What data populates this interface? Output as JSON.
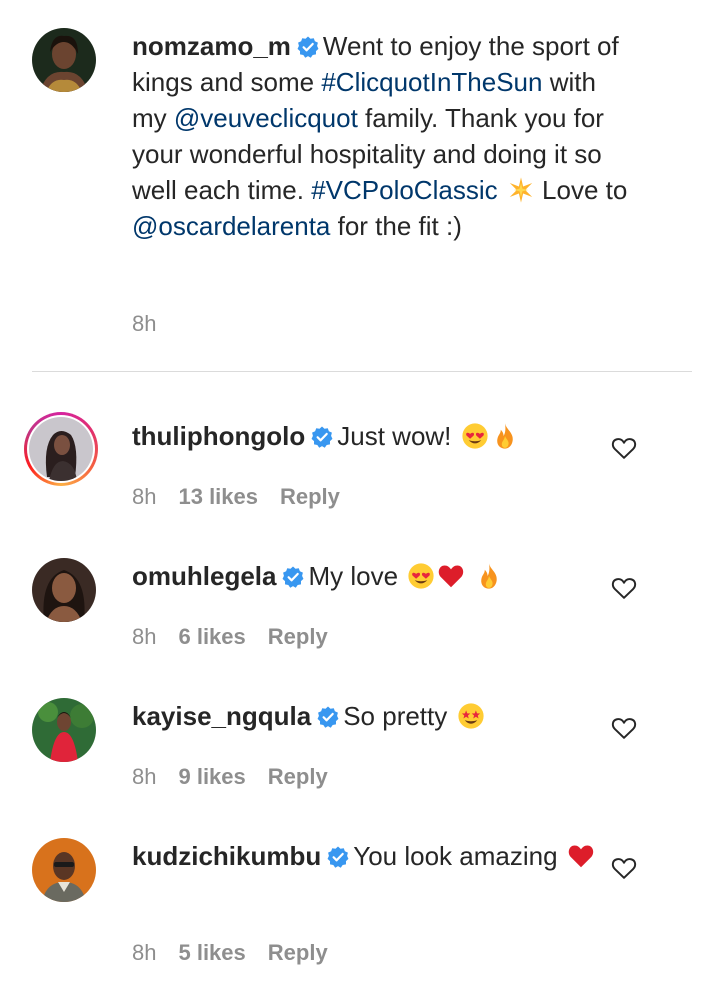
{
  "caption": {
    "username": "nomzamo_m",
    "text_1": "Went to enjoy the sport of kings and some ",
    "hashtag_1": "#ClicquotInTheSun",
    "text_2": " with my ",
    "mention_1": "@veuveclicquot",
    "text_3": " family. Thank you for your wonderful hospitality and doing it so well each time. ",
    "hashtag_2": "#VCPoloClassic",
    "emoji_1": "sparkle",
    "text_4": " Love to ",
    "mention_2": "@oscardelarenta",
    "text_5": " for the fit :)",
    "time": "8h"
  },
  "comments": [
    {
      "username": "thuliphongolo",
      "text": "Just wow!",
      "emojis": [
        "heart-eyes",
        "fire"
      ],
      "time": "8h",
      "likes": "13 likes",
      "reply": "Reply"
    },
    {
      "username": "omuhlegela",
      "text": "My love",
      "emojis": [
        "heart-eyes",
        "red-heart",
        "fire"
      ],
      "time": "8h",
      "likes": "6 likes",
      "reply": "Reply"
    },
    {
      "username": "kayise_ngqula",
      "text": "So pretty",
      "emojis": [
        "star-struck"
      ],
      "time": "8h",
      "likes": "9 likes",
      "reply": "Reply"
    },
    {
      "username": "kudzichikumbu",
      "text": "You look amazing",
      "emojis": [
        "red-heart"
      ],
      "time": "8h",
      "likes": "5 likes",
      "reply": "Reply"
    }
  ],
  "colors": {
    "link": "#00376b",
    "verified": "#3897f0",
    "meta": "#8e8e8e"
  }
}
